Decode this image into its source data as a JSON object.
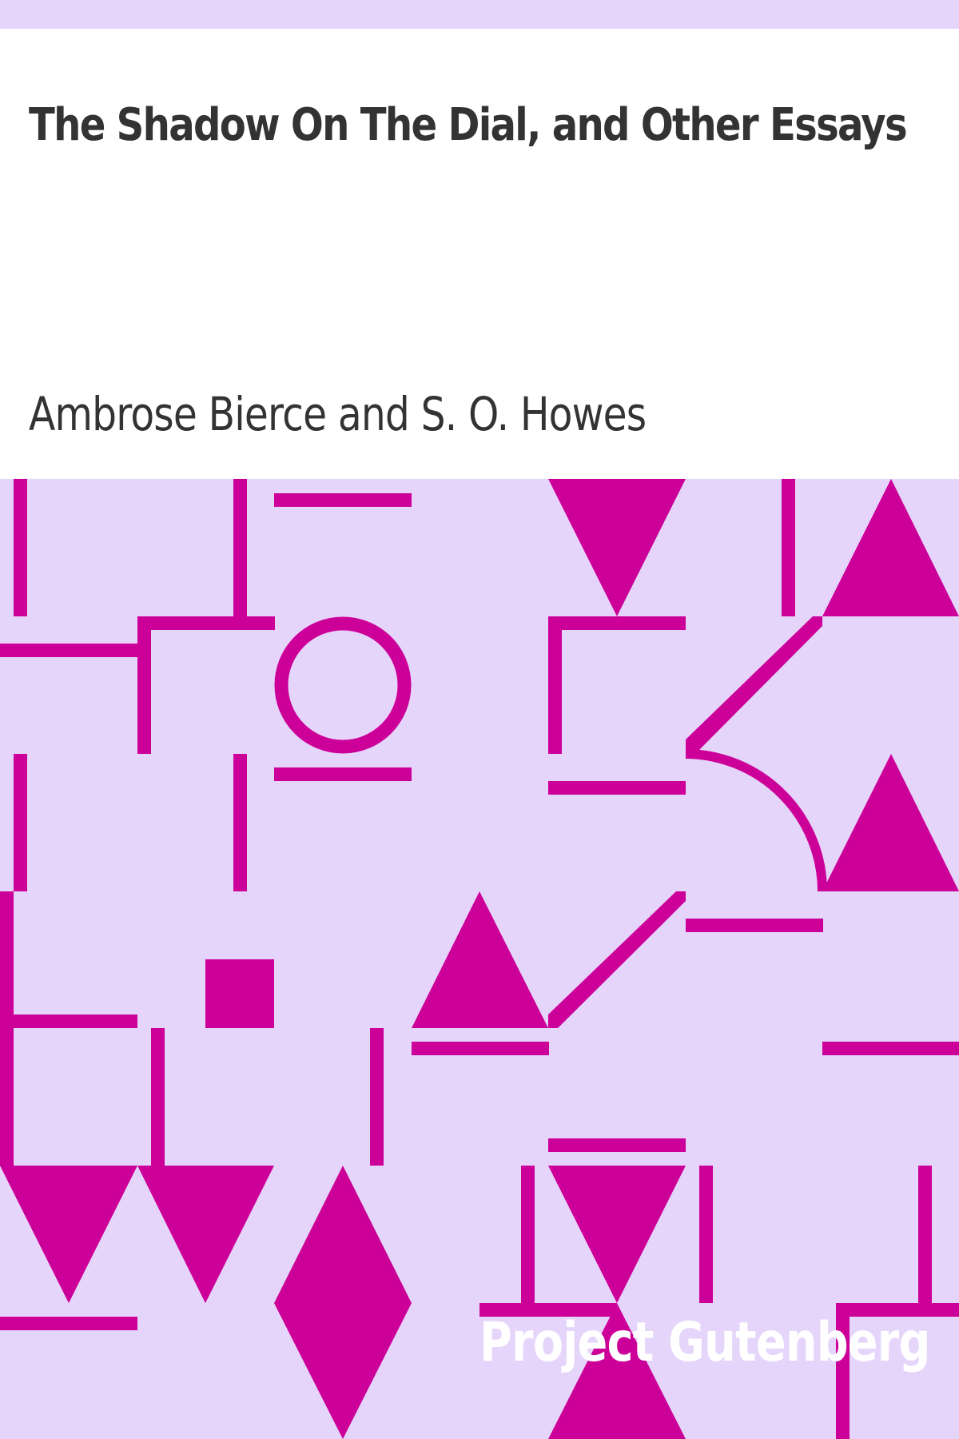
{
  "book": {
    "title": "The Shadow On The Dial, and Other Essays",
    "author": "Ambrose Bierce and S. O. Howes"
  },
  "publisher": {
    "name": "Project Gutenberg"
  },
  "colors": {
    "background": "#e6d5fb",
    "panel": "#ffffff",
    "text": "#333333",
    "pattern": "#cc0099",
    "brand_text": "#ffffff"
  }
}
